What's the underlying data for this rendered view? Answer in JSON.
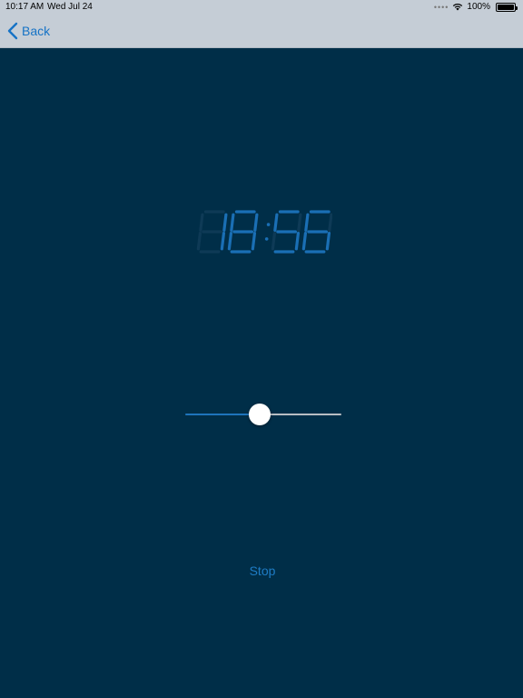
{
  "status_bar": {
    "time": "10:17 AM",
    "date": "Wed Jul 24",
    "battery": "100%",
    "signal_icon": "cellular-dots-icon",
    "wifi_icon": "wifi-icon",
    "battery_icon": "battery-icon"
  },
  "nav": {
    "back_label": "Back",
    "back_icon": "chevron-left-icon"
  },
  "clock": {
    "display": "18:56",
    "color": "#1A6FB5",
    "dim_color": "#0E3A56"
  },
  "slider": {
    "value": 0.48,
    "min_track_color": "#1E74BB",
    "max_track_color": "#B8BDC3"
  },
  "stop_label": "Stop",
  "colors": {
    "background": "#002E48",
    "navbar": "#C5CDD6",
    "tint": "#1673C6"
  }
}
